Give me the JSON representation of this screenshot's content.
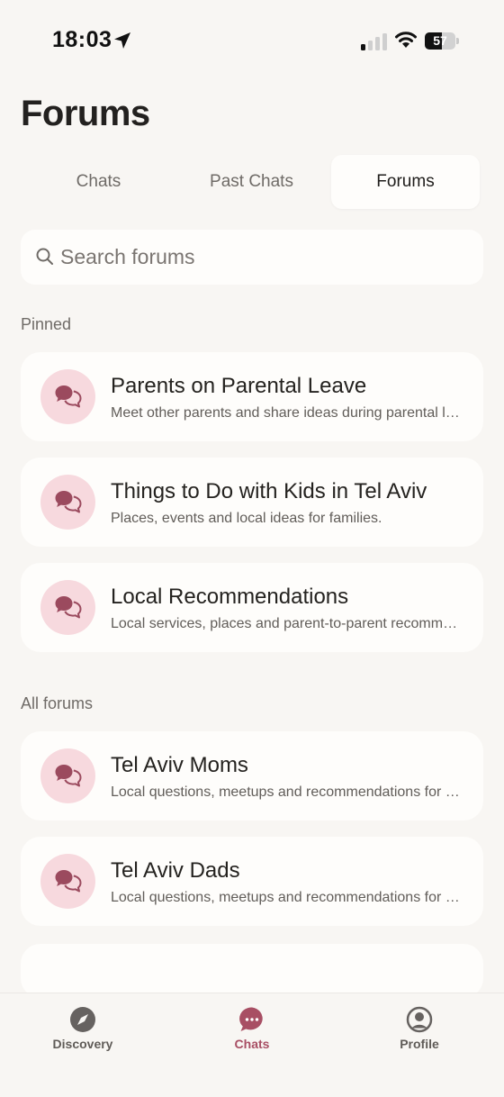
{
  "status_bar": {
    "time": "18:03",
    "battery": "57",
    "battery_level": 0.57
  },
  "page_title": "Forums",
  "tabs": [
    {
      "label": "Chats",
      "active": false
    },
    {
      "label": "Past Chats",
      "active": false
    },
    {
      "label": "Forums",
      "active": true
    }
  ],
  "search": {
    "placeholder": "Search forums",
    "value": ""
  },
  "sections": {
    "pinned": "Pinned",
    "all": "All forums"
  },
  "pinned": [
    {
      "title": "Parents on Parental Leave",
      "desc": "Meet other parents and share ideas during parental leave.",
      "icon": "chat-bubbles-icon"
    },
    {
      "title": "Things to Do with Kids in Tel Aviv",
      "desc": "Places, events and local ideas for families.",
      "icon": "chat-bubbles-icon"
    },
    {
      "title": "Local Recommendations",
      "desc": "Local services, places and parent-to-parent recommendations.",
      "icon": "chat-bubbles-icon"
    }
  ],
  "all_forums": [
    {
      "title": "Tel Aviv Moms",
      "desc": "Local questions, meetups and recommendations for moms.",
      "icon": "chat-bubbles-icon"
    },
    {
      "title": "Tel Aviv Dads",
      "desc": "Local questions, meetups and recommendations for dads.",
      "icon": "chat-bubbles-icon"
    }
  ],
  "bottom_nav": [
    {
      "label": "Discovery",
      "icon": "compass-icon",
      "active": false
    },
    {
      "label": "Chats",
      "icon": "chat-dots-icon",
      "active": true
    },
    {
      "label": "Profile",
      "icon": "profile-icon",
      "active": false
    }
  ],
  "colors": {
    "accent": "#a84f64",
    "avatar_bg": "#f7d9de",
    "background": "#f8f6f3",
    "card": "#fefdfb"
  }
}
